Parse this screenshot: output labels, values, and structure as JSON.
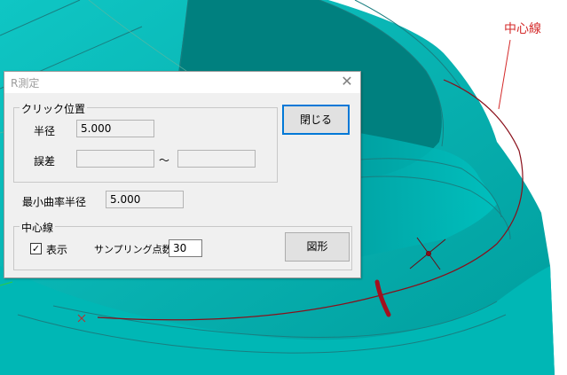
{
  "annotation": {
    "center_line_label": "中心線"
  },
  "dialog": {
    "title": "R測定",
    "close_glyph": "✕",
    "click_position_group": {
      "legend": "クリック位置",
      "radius_label": "半径",
      "radius_value": "5.000",
      "error_label": "誤差",
      "error_min": "",
      "error_separator": "〜",
      "error_max": ""
    },
    "close_button": "閉じる",
    "min_curvature_radius_label": "最小曲率半径",
    "min_curvature_radius_value": "5.000",
    "center_line_group": {
      "legend": "中心線",
      "show_label": "表示",
      "show_checked": true,
      "sampling_label": "サンプリング点数",
      "sampling_value": "30",
      "shape_button": "図形"
    }
  },
  "colors": {
    "model": "#00b3b3",
    "model_dark": "#007e80",
    "center_line": "#8a0f1a",
    "annotation": "#d42a2a"
  }
}
